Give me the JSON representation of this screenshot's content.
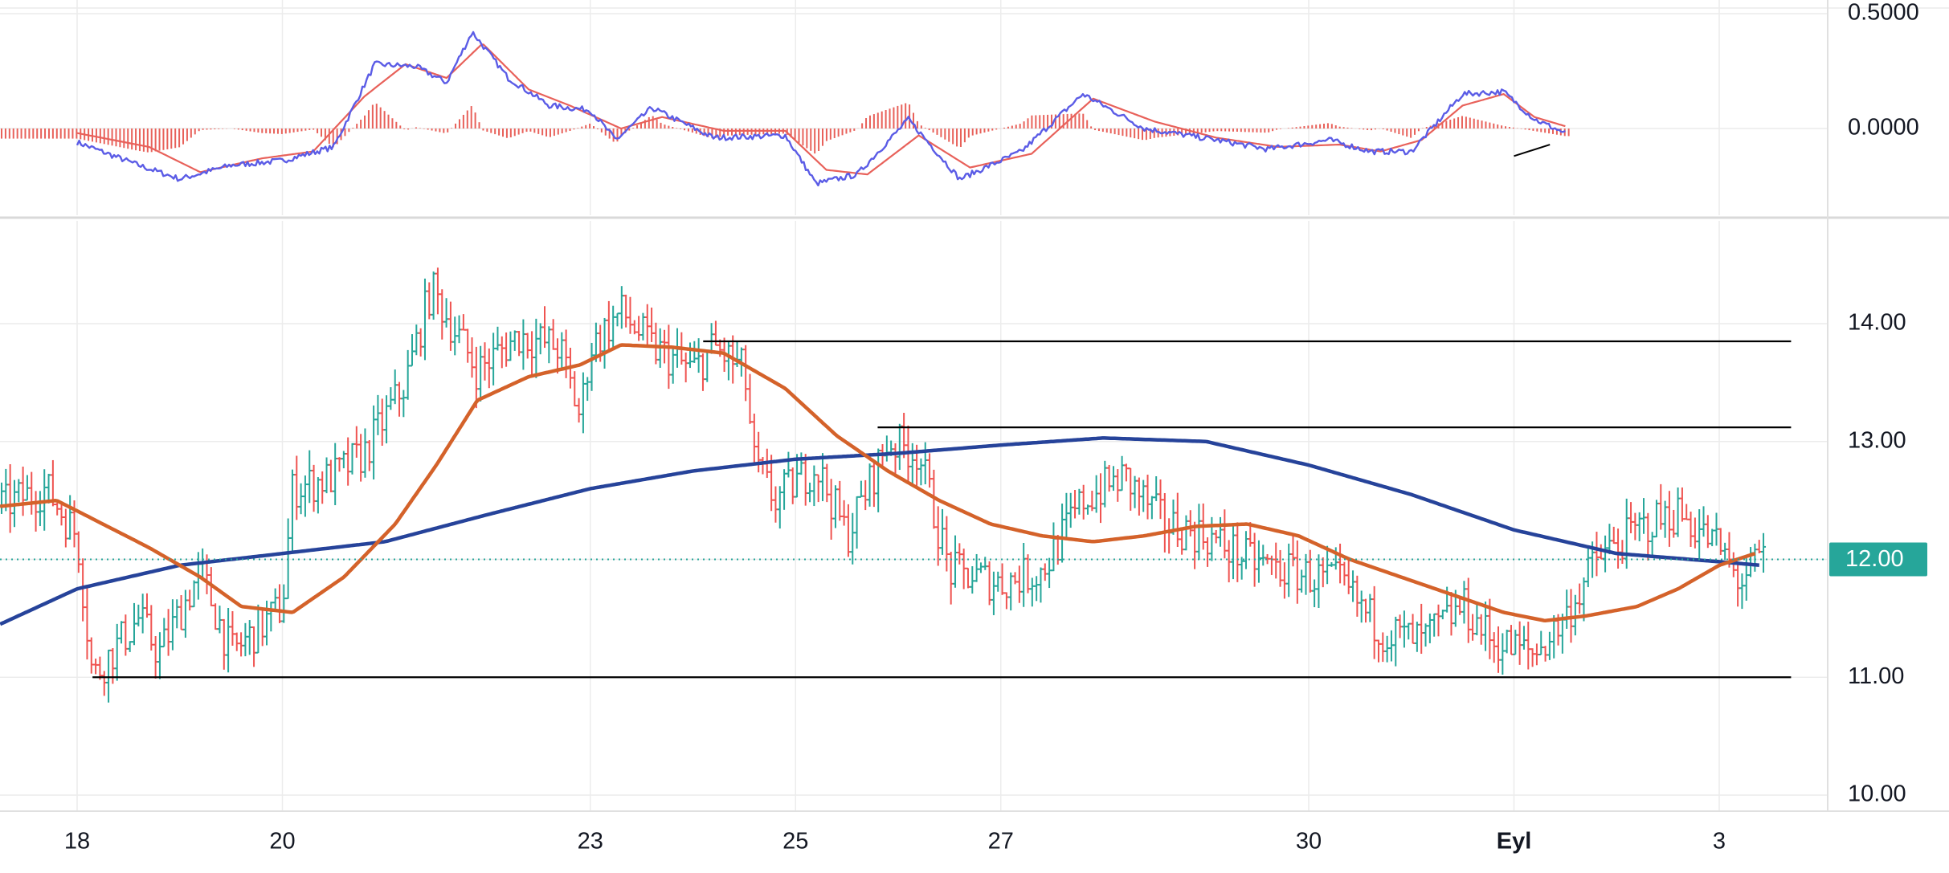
{
  "chart_data": [
    {
      "type": "line",
      "panel": "macd",
      "y_ticks": [
        {
          "value": 0.5,
          "label": "0.5000"
        },
        {
          "value": 0.0,
          "label": "0.0000"
        }
      ],
      "ylim": [
        -0.3,
        0.52
      ],
      "grid": true,
      "series": [
        {
          "role": "macd",
          "color": "#5b5ce6",
          "points": [
            [
              0,
              -0.06
            ],
            [
              0.6,
              -0.16
            ],
            [
              1.0,
              -0.22
            ],
            [
              1.5,
              -0.16
            ],
            [
              2.0,
              -0.14
            ],
            [
              2.5,
              -0.08
            ],
            [
              2.9,
              0.28
            ],
            [
              3.3,
              0.27
            ],
            [
              3.6,
              0.2
            ],
            [
              3.85,
              0.42
            ],
            [
              4.2,
              0.22
            ],
            [
              4.6,
              0.1
            ],
            [
              5.0,
              0.08
            ],
            [
              5.25,
              -0.05
            ],
            [
              5.6,
              0.09
            ],
            [
              6.2,
              -0.04
            ],
            [
              6.9,
              -0.03
            ],
            [
              7.2,
              -0.24
            ],
            [
              7.6,
              -0.2
            ],
            [
              8.1,
              0.04
            ],
            [
              8.6,
              -0.22
            ],
            [
              9.2,
              -0.1
            ],
            [
              9.8,
              0.15
            ],
            [
              10.4,
              0.0
            ],
            [
              11.1,
              -0.05
            ],
            [
              11.6,
              -0.09
            ],
            [
              12.2,
              -0.05
            ],
            [
              12.6,
              -0.1
            ],
            [
              13.0,
              -0.1
            ],
            [
              13.5,
              0.15
            ],
            [
              13.9,
              0.16
            ],
            [
              14.2,
              0.04
            ],
            [
              14.5,
              -0.02
            ]
          ]
        },
        {
          "role": "signal",
          "color": "#e8615a",
          "points": [
            [
              0,
              -0.02
            ],
            [
              0.7,
              -0.08
            ],
            [
              1.2,
              -0.19
            ],
            [
              1.8,
              -0.13
            ],
            [
              2.3,
              -0.1
            ],
            [
              2.8,
              0.14
            ],
            [
              3.2,
              0.28
            ],
            [
              3.6,
              0.22
            ],
            [
              3.95,
              0.37
            ],
            [
              4.4,
              0.17
            ],
            [
              4.8,
              0.1
            ],
            [
              5.3,
              0.0
            ],
            [
              5.7,
              0.05
            ],
            [
              6.3,
              -0.01
            ],
            [
              6.9,
              -0.01
            ],
            [
              7.3,
              -0.18
            ],
            [
              7.7,
              -0.2
            ],
            [
              8.2,
              -0.03
            ],
            [
              8.7,
              -0.17
            ],
            [
              9.3,
              -0.11
            ],
            [
              9.9,
              0.13
            ],
            [
              10.5,
              0.03
            ],
            [
              11.1,
              -0.04
            ],
            [
              11.7,
              -0.08
            ],
            [
              12.3,
              -0.07
            ],
            [
              12.7,
              -0.1
            ],
            [
              13.1,
              -0.05
            ],
            [
              13.5,
              0.1
            ],
            [
              13.9,
              0.15
            ],
            [
              14.2,
              0.05
            ],
            [
              14.5,
              0.01
            ]
          ]
        }
      ],
      "histogram_color": "#e8615a",
      "annotation": {
        "points": [
          [
            14.0,
            -0.12
          ],
          [
            14.35,
            -0.07
          ]
        ]
      }
    },
    {
      "type": "bar",
      "panel": "price",
      "x_ticks": [
        {
          "x": 0.0,
          "label": "18"
        },
        {
          "x": 2.0,
          "label": "20"
        },
        {
          "x": 5.0,
          "label": "23"
        },
        {
          "x": 7.0,
          "label": "25"
        },
        {
          "x": 9.0,
          "label": "27"
        },
        {
          "x": 12.0,
          "label": "30"
        },
        {
          "x": 14.0,
          "label": "Eyl"
        },
        {
          "x": 16.0,
          "label": "3"
        }
      ],
      "y_ticks": [
        {
          "value": 14.0,
          "label": "14.00"
        },
        {
          "value": 13.0,
          "label": "13.00"
        },
        {
          "value": 11.0,
          "label": "11.00"
        },
        {
          "value": 10.0,
          "label": "10.00"
        }
      ],
      "xlim": [
        -0.75,
        17.5
      ],
      "ylim": [
        9.99,
        15.0
      ],
      "grid": true,
      "price_path": [
        [
          -0.75,
          12.45
        ],
        [
          -0.3,
          12.6
        ],
        [
          0.0,
          12.2
        ],
        [
          0.15,
          11.0
        ],
        [
          0.6,
          11.5
        ],
        [
          0.8,
          11.2
        ],
        [
          1.2,
          11.9
        ],
        [
          1.5,
          11.2
        ],
        [
          2.0,
          11.6
        ],
        [
          2.1,
          12.6
        ],
        [
          2.5,
          12.7
        ],
        [
          2.8,
          12.9
        ],
        [
          3.2,
          13.5
        ],
        [
          3.45,
          14.3
        ],
        [
          3.9,
          13.6
        ],
        [
          4.3,
          13.9
        ],
        [
          4.7,
          13.8
        ],
        [
          4.9,
          13.2
        ],
        [
          5.0,
          13.8
        ],
        [
          5.3,
          14.1
        ],
        [
          5.6,
          13.8
        ],
        [
          6.0,
          13.6
        ],
        [
          6.2,
          13.8
        ],
        [
          6.5,
          13.6
        ],
        [
          6.6,
          12.8
        ],
        [
          6.8,
          12.5
        ],
        [
          7.2,
          12.8
        ],
        [
          7.5,
          12.2
        ],
        [
          7.9,
          13.0
        ],
        [
          8.2,
          12.9
        ],
        [
          8.5,
          11.9
        ],
        [
          9.0,
          11.8
        ],
        [
          9.4,
          11.9
        ],
        [
          9.8,
          12.5
        ],
        [
          10.2,
          12.7
        ],
        [
          10.6,
          12.3
        ],
        [
          11.0,
          12.2
        ],
        [
          11.4,
          12.0
        ],
        [
          11.8,
          11.9
        ],
        [
          12.3,
          11.8
        ],
        [
          12.7,
          11.4
        ],
        [
          13.1,
          11.3
        ],
        [
          13.5,
          11.6
        ],
        [
          13.8,
          11.3
        ],
        [
          14.2,
          11.2
        ],
        [
          14.5,
          11.5
        ],
        [
          14.8,
          12.0
        ],
        [
          15.3,
          12.3
        ],
        [
          15.6,
          12.4
        ],
        [
          16.0,
          12.1
        ],
        [
          16.2,
          11.8
        ],
        [
          16.4,
          12.0
        ]
      ],
      "series": [
        {
          "role": "moving-average-200",
          "color": "#26439a",
          "points": [
            [
              -0.75,
              11.45
            ],
            [
              0.0,
              11.75
            ],
            [
              1.0,
              11.95
            ],
            [
              2.0,
              12.05
            ],
            [
              3.0,
              12.15
            ],
            [
              4.0,
              12.38
            ],
            [
              5.0,
              12.6
            ],
            [
              6.0,
              12.75
            ],
            [
              7.0,
              12.85
            ],
            [
              8.0,
              12.9
            ],
            [
              9.0,
              12.97
            ],
            [
              10.0,
              13.03
            ],
            [
              11.0,
              13.0
            ],
            [
              12.0,
              12.8
            ],
            [
              13.0,
              12.55
            ],
            [
              14.0,
              12.25
            ],
            [
              15.0,
              12.05
            ],
            [
              16.0,
              11.98
            ],
            [
              16.4,
              11.95
            ]
          ]
        },
        {
          "role": "moving-average-50",
          "color": "#d4622a",
          "points": [
            [
              -0.75,
              12.45
            ],
            [
              -0.2,
              12.5
            ],
            [
              0.7,
              12.1
            ],
            [
              1.2,
              11.85
            ],
            [
              1.6,
              11.6
            ],
            [
              2.1,
              11.55
            ],
            [
              2.6,
              11.85
            ],
            [
              3.1,
              12.3
            ],
            [
              3.5,
              12.8
            ],
            [
              3.9,
              13.35
            ],
            [
              4.4,
              13.55
            ],
            [
              4.9,
              13.65
            ],
            [
              5.3,
              13.82
            ],
            [
              5.8,
              13.8
            ],
            [
              6.3,
              13.75
            ],
            [
              6.9,
              13.45
            ],
            [
              7.4,
              13.05
            ],
            [
              7.9,
              12.75
            ],
            [
              8.4,
              12.5
            ],
            [
              8.9,
              12.3
            ],
            [
              9.4,
              12.2
            ],
            [
              9.9,
              12.15
            ],
            [
              10.4,
              12.2
            ],
            [
              10.9,
              12.28
            ],
            [
              11.4,
              12.3
            ],
            [
              11.9,
              12.2
            ],
            [
              12.4,
              12.0
            ],
            [
              12.9,
              11.85
            ],
            [
              13.4,
              11.7
            ],
            [
              13.9,
              11.55
            ],
            [
              14.3,
              11.48
            ],
            [
              14.7,
              11.52
            ],
            [
              15.2,
              11.6
            ],
            [
              15.6,
              11.75
            ],
            [
              16.0,
              11.95
            ],
            [
              16.35,
              12.05
            ]
          ]
        }
      ],
      "bar_colors": {
        "up": "#26a69a",
        "down": "#ef5350"
      },
      "current_price": {
        "value": 12.0,
        "label": "12.00",
        "color": "#26a69a"
      },
      "horizontal_lines": [
        {
          "y": 13.85,
          "x_start": 6.1,
          "x_end": 16.7,
          "color": "#000000"
        },
        {
          "y": 13.12,
          "x_start": 7.8,
          "x_end": 16.7,
          "color": "#000000"
        },
        {
          "y": 11.0,
          "x_start": 0.15,
          "x_end": 16.7,
          "color": "#000000"
        }
      ]
    }
  ]
}
